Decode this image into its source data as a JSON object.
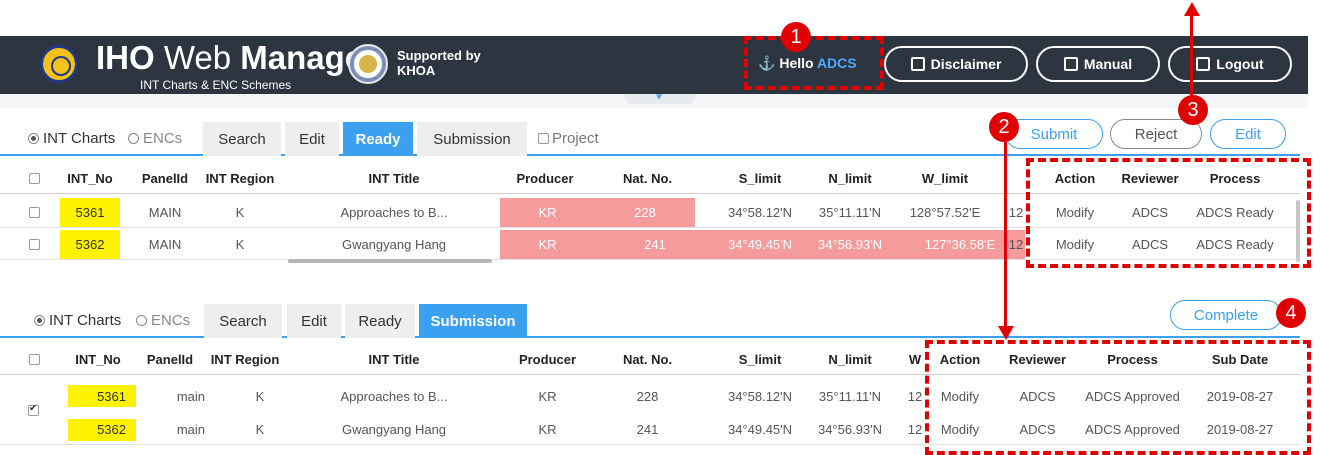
{
  "header": {
    "brand_bold": "IHO",
    "brand_thin": " Web ",
    "brand_bold2": "Manager",
    "brand_sub": "INT Charts & ENC Schemes",
    "supported": "Supported by\nKHOA",
    "hello_prefix": "Hello ",
    "hello_user": "ADCS",
    "disclaimer": "Disclaimer",
    "manual": "Manual",
    "logout": "Logout",
    "bg_color": "#2d3540"
  },
  "ready_panel": {
    "radio_int": "INT Charts",
    "radio_enc": "ENCs",
    "tabs": [
      "Search",
      "Edit",
      "Ready",
      "Submission"
    ],
    "project_label": "Project",
    "actions": {
      "submit": "Submit",
      "reject": "Reject",
      "edit": "Edit"
    },
    "headers": [
      "INT_No",
      "PanelId",
      "INT Region",
      "INT Title",
      "Producer",
      "Nat. No.",
      "S_limit",
      "N_limit",
      "W_limit",
      "Action",
      "Reviewer",
      "Process"
    ],
    "rows": [
      {
        "int_no": "5361",
        "panel": "MAIN",
        "region": "K",
        "title": "Approaches to B...",
        "producer": "KR",
        "nat_no": "228",
        "s_limit": "34°58.12'N",
        "n_limit": "35°11.11'N",
        "w_limit": "128°57.52'E",
        "extra": "12",
        "action": "Modify",
        "reviewer": "ADCS",
        "process": "ADCS Ready"
      },
      {
        "int_no": "5362",
        "panel": "MAIN",
        "region": "K",
        "title": "Gwangyang Hang",
        "producer": "KR",
        "nat_no": "241",
        "s_limit": "34°49.45'N",
        "n_limit": "34°56.93'N",
        "w_limit": "127°36.58'E",
        "extra": "12",
        "action": "Modify",
        "reviewer": "ADCS",
        "process": "ADCS Ready"
      }
    ]
  },
  "submission_panel": {
    "radio_int": "INT Charts",
    "radio_enc": "ENCs",
    "tabs": [
      "Search",
      "Edit",
      "Ready",
      "Submission"
    ],
    "complete": "Complete",
    "headers": [
      "INT_No",
      "PanelId",
      "INT Region",
      "INT Title",
      "Producer",
      "Nat. No.",
      "S_limit",
      "N_limit",
      "W",
      "Action",
      "Reviewer",
      "Process",
      "Sub Date"
    ],
    "rows": [
      {
        "int_no": "5361",
        "panel": "main",
        "region": "K",
        "title": "Approaches to B...",
        "producer": "KR",
        "nat_no": "228",
        "s_limit": "34°58.12'N",
        "n_limit": "35°11.11'N",
        "w": "12",
        "action": "Modify",
        "reviewer": "ADCS",
        "process": "ADCS Approved",
        "sub_date": "2019-08-27"
      },
      {
        "int_no": "5362",
        "panel": "main",
        "region": "K",
        "title": "Gwangyang Hang",
        "producer": "KR",
        "nat_no": "241",
        "s_limit": "34°49.45'N",
        "n_limit": "34°56.93'N",
        "w": "12",
        "action": "Modify",
        "reviewer": "ADCS",
        "process": "ADCS Approved",
        "sub_date": "2019-08-27"
      }
    ]
  },
  "annotations": {
    "b1": "1",
    "b2": "2",
    "b3": "3",
    "b4": "4"
  },
  "colors": {
    "accent": "#3aa0ef",
    "highlight_yellow": "#fff200",
    "highlight_pink": "#f59b9b",
    "annotation_red": "#e00000"
  }
}
